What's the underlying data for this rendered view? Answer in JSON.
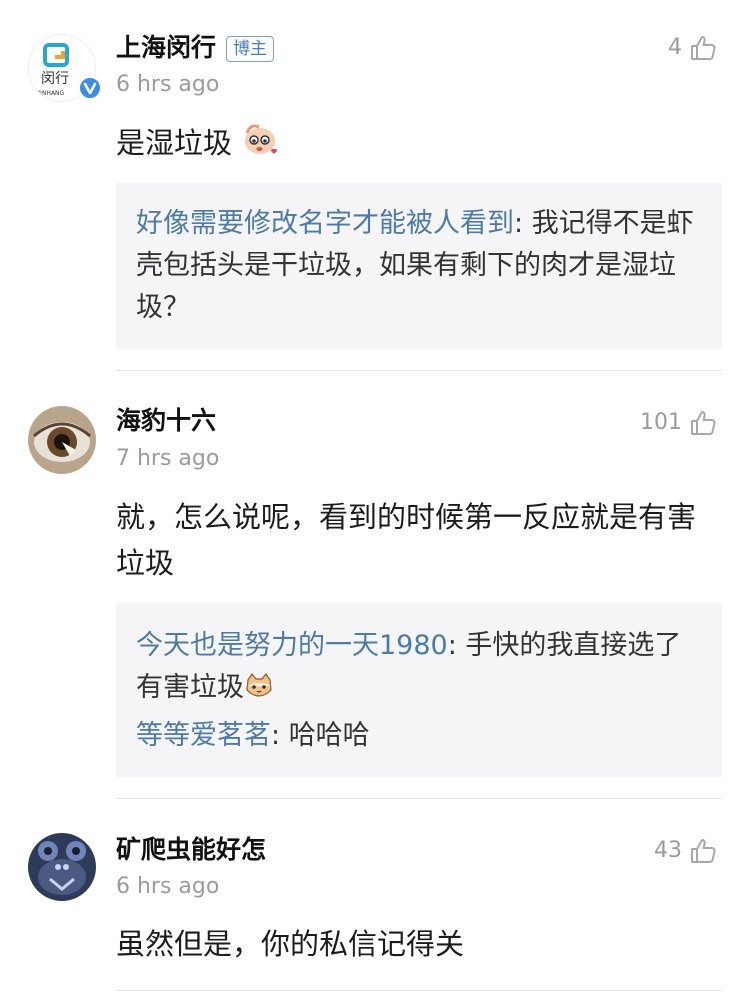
{
  "comments": [
    {
      "username": "上海闵行",
      "badge": "博主",
      "time": "6 hrs ago",
      "likes": "4",
      "text": "是湿垃圾",
      "avatar_text": "闵行",
      "avatar_subtext": "MINHANG",
      "replies": [
        {
          "author": "好像需要修改名字才能被人看到",
          "sep": ": ",
          "text": "我记得不是虾壳包括头是干垃圾，如果有剩下的肉才是湿垃圾？"
        }
      ]
    },
    {
      "username": "海豹十六",
      "time": "7 hrs ago",
      "likes": "101",
      "text": "就，怎么说呢，看到的时候第一反应就是有害垃圾",
      "replies": [
        {
          "author": "今天也是努力的一天1980",
          "sep": ": ",
          "text": "手快的我直接选了有害垃圾"
        },
        {
          "author": "等等爱茗茗",
          "sep": ": ",
          "text": "哈哈哈"
        }
      ]
    },
    {
      "username": "矿爬虫能好怎",
      "time": "6 hrs ago",
      "likes": "43",
      "text": "虽然但是，你的私信记得关"
    }
  ],
  "colors": {
    "link": "#4d7aa6",
    "muted": "#9b9b9b",
    "reply_bg": "#f5f5f7",
    "verified": "#3b8fe0"
  },
  "icons": {
    "like": "thumbs-up-icon",
    "verified": "verified-v-icon"
  }
}
